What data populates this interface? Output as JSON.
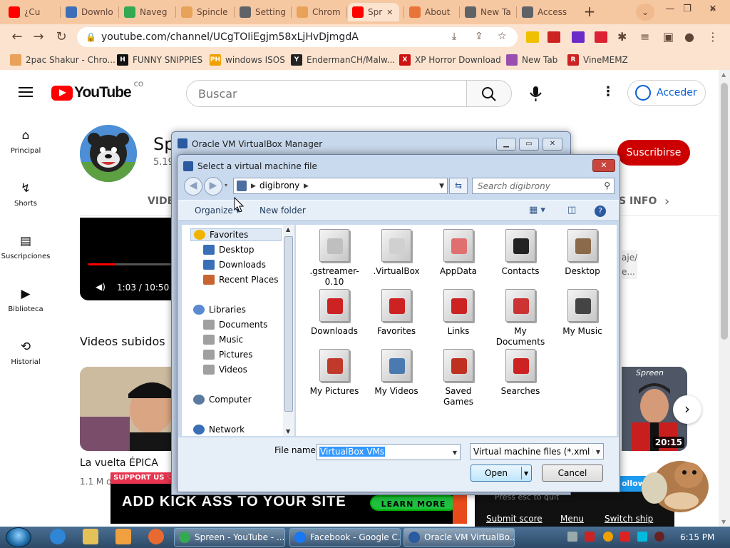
{
  "browser": {
    "tabs": [
      {
        "label": "¿Cu",
        "color": "#ff0000"
      },
      {
        "label": "Downlo",
        "color": "#3d6fb6"
      },
      {
        "label": "Naveg",
        "color": "#34a853"
      },
      {
        "label": "Spincle",
        "color": "#e8a25a"
      },
      {
        "label": "Setting",
        "color": "#5f6368"
      },
      {
        "label": "Chrom",
        "color": "#e8a25a"
      },
      {
        "label": "Spr",
        "color": "#ff0000"
      },
      {
        "label": "About",
        "color": "#e8743a"
      },
      {
        "label": "New Ta",
        "color": "#5f6368"
      },
      {
        "label": "Access",
        "color": "#5f6368"
      }
    ],
    "active_tab_index": 6,
    "new_tab_symbol": "+",
    "window_controls": {
      "minimize": "—",
      "restore": "❐",
      "close": "✕"
    },
    "url": "youtube.com/channel/UCgTOIiEgjm58xLjHvDjmgdA",
    "bookmarks": [
      {
        "label": "2pac Shakur - Chro...",
        "icon": "chrome-ext",
        "color": "#e8a25a"
      },
      {
        "label": "FUNNY SNIPPIES",
        "icon": "H",
        "color": "#111111"
      },
      {
        "label": "windows ISOS",
        "icon": "PH",
        "color": "#f0a000"
      },
      {
        "label": "EndermanCH/Malw...",
        "icon": "Y",
        "color": "#222222"
      },
      {
        "label": "XP Horror Download",
        "icon": "X",
        "color": "#cc1111"
      },
      {
        "label": "New Tab",
        "icon": "spiral",
        "color": "#9a4fb0"
      },
      {
        "label": "VineMEMZ",
        "icon": "R",
        "color": "#cc2222"
      }
    ],
    "more_bookmarks_symbol": "»",
    "extension_colors": [
      "#f0c000",
      "#cc2222",
      "#6a2bc9",
      "#d23"
    ]
  },
  "youtube": {
    "logo_text": "YouTube",
    "country_code": "CO",
    "search_placeholder": "Buscar",
    "signin_label": "Acceder",
    "sidebar": [
      {
        "label": "Principal",
        "icon": "home-icon",
        "glyph": "⌂"
      },
      {
        "label": "Shorts",
        "icon": "shorts-icon",
        "glyph": "↯"
      },
      {
        "label": "Suscripciones",
        "icon": "subscriptions-icon",
        "glyph": "▤"
      },
      {
        "label": "Biblioteca",
        "icon": "library-icon",
        "glyph": "▶"
      },
      {
        "label": "Historial",
        "icon": "history-icon",
        "glyph": "⟲"
      }
    ],
    "channel_name_visible": "Sp",
    "subs_visible": "5.19",
    "subscribe_label": "Suscribirse",
    "tab_videos_visible": "VIDE",
    "tab_info_visible": "S INFO",
    "player_time": "1:03 / 10:50",
    "player_progress": 0.1,
    "desc_line1": "aje/",
    "desc_line2": "e...",
    "section_title": "Videos subidos",
    "video_title": "La vuelta ÉPICA",
    "video_meta": "1.1 M de",
    "thumb2_name": "Spreen",
    "thumb2_duration": "20:15"
  },
  "ad": {
    "support_label": "SUPPORT US ♡",
    "headline": "ADD KICK ASS TO YOUR SITE",
    "cta": "LEARN MORE",
    "esc_hint": "Press esc to quit",
    "links": [
      "Submit score",
      "Menu",
      "Switch ship"
    ],
    "follow": "ollow +"
  },
  "vbox_manager": {
    "title": "Oracle VM VirtualBox Manager"
  },
  "dialog": {
    "title": "Select a virtual machine file",
    "path": "digibrony",
    "search_placeholder": "Search digibrony",
    "organize_label": "Organize",
    "new_folder_label": "New folder",
    "nav_items": [
      {
        "label": "Favorites",
        "indent": 0,
        "color": "#f0b400",
        "selected": true
      },
      {
        "label": "Desktop",
        "indent": 1,
        "color": "#3a6fb8"
      },
      {
        "label": "Downloads",
        "indent": 1,
        "color": "#3a6fb8"
      },
      {
        "label": "Recent Places",
        "indent": 1,
        "color": "#c86430"
      },
      {
        "label": "Libraries",
        "indent": 0,
        "color": "#5a8ad0"
      },
      {
        "label": "Documents",
        "indent": 1,
        "color": "#a0a0a0"
      },
      {
        "label": "Music",
        "indent": 1,
        "color": "#a0a0a0"
      },
      {
        "label": "Pictures",
        "indent": 1,
        "color": "#a0a0a0"
      },
      {
        "label": "Videos",
        "indent": 1,
        "color": "#a0a0a0"
      },
      {
        "label": "Computer",
        "indent": 0,
        "color": "#5a7aa0"
      },
      {
        "label": "Network",
        "indent": 0,
        "color": "#3a6fb8"
      }
    ],
    "files": [
      {
        "label": ".gstreamer-0.10",
        "mark": "#bfbfbf"
      },
      {
        "label": ".VirtualBox",
        "mark": "#d0d0d0"
      },
      {
        "label": "AppData",
        "mark": "#e07070"
      },
      {
        "label": "Contacts",
        "mark": "#222222"
      },
      {
        "label": "Desktop",
        "mark": "#8a6a4a"
      },
      {
        "label": "Downloads",
        "mark": "#cc2222"
      },
      {
        "label": "Favorites",
        "mark": "#cc2222"
      },
      {
        "label": "Links",
        "mark": "#cc2222"
      },
      {
        "label": "My Documents",
        "mark": "#cc3333"
      },
      {
        "label": "My Music",
        "mark": "#444444"
      },
      {
        "label": "My Pictures",
        "mark": "#c0392b"
      },
      {
        "label": "My Videos",
        "mark": "#4a7ab0"
      },
      {
        "label": "Saved Games",
        "mark": "#c03020"
      },
      {
        "label": "Searches",
        "mark": "#cc2222"
      }
    ],
    "filename_label": "File name:",
    "filename_value": "VirtualBox VMs",
    "filetype": "Virtual machine files (*.xml *.vb",
    "open_label": "Open",
    "cancel_label": "Cancel"
  },
  "taskbar": {
    "buttons": [
      {
        "label": "Spreen - YouTube - ...",
        "color": "#34a853"
      },
      {
        "label": "Facebook - Google C...",
        "color": "#1877f2"
      },
      {
        "label": "Oracle VM VirtualBo...",
        "color": "#2a5aa0"
      }
    ],
    "clock": "6:15 PM"
  }
}
